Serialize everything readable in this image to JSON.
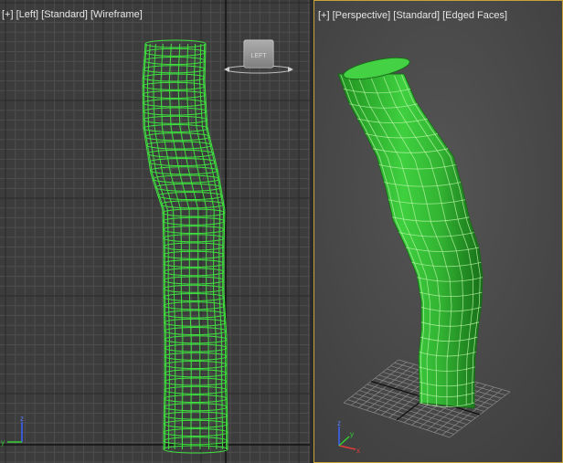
{
  "viewports": {
    "left": {
      "label": {
        "plus": "[+]",
        "view": "[Left]",
        "shading": "[Standard]",
        "mode": "[Wireframe]"
      },
      "viewcube_face": "LEFT"
    },
    "perspective": {
      "label": {
        "plus": "[+]",
        "view": "[Perspective]",
        "shading": "[Standard]",
        "mode": "[Edged Faces]"
      }
    }
  },
  "axes": {
    "z": "z",
    "y": "y",
    "x": "x"
  },
  "colors": {
    "wire": "#3fe33f",
    "mesh_fill": "#36c436",
    "grid_left": "#4f4f4f",
    "active_border": "#c8a23a"
  },
  "icons": [
    "viewcube-icon",
    "axis-tripod-icon"
  ]
}
